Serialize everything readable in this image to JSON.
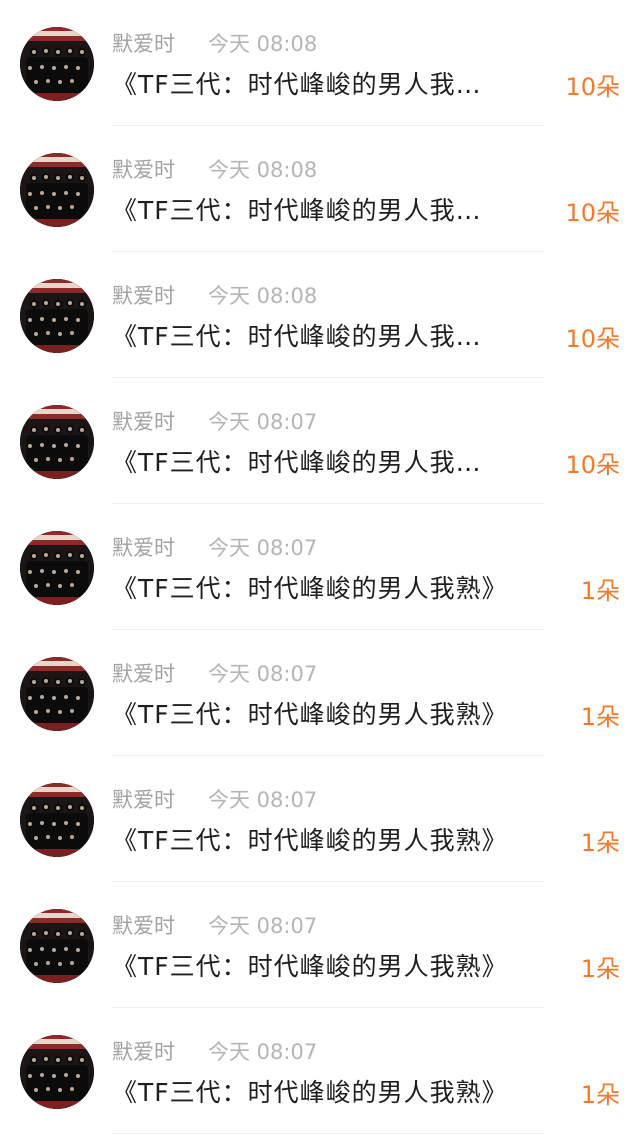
{
  "messages": [
    {
      "sender": "默爱时",
      "time": "今天 08:08",
      "title": "《TF三代：时代峰峻的男人我…",
      "gift": "10朵"
    },
    {
      "sender": "默爱时",
      "time": "今天 08:08",
      "title": "《TF三代：时代峰峻的男人我…",
      "gift": "10朵"
    },
    {
      "sender": "默爱时",
      "time": "今天 08:08",
      "title": "《TF三代：时代峰峻的男人我…",
      "gift": "10朵"
    },
    {
      "sender": "默爱时",
      "time": "今天 08:07",
      "title": "《TF三代：时代峰峻的男人我…",
      "gift": "10朵"
    },
    {
      "sender": "默爱时",
      "time": "今天 08:07",
      "title": "《TF三代：时代峰峻的男人我熟》",
      "gift": "1朵"
    },
    {
      "sender": "默爱时",
      "time": "今天 08:07",
      "title": "《TF三代：时代峰峻的男人我熟》",
      "gift": "1朵"
    },
    {
      "sender": "默爱时",
      "time": "今天 08:07",
      "title": "《TF三代：时代峰峻的男人我熟》",
      "gift": "1朵"
    },
    {
      "sender": "默爱时",
      "time": "今天 08:07",
      "title": "《TF三代：时代峰峻的男人我熟》",
      "gift": "1朵"
    },
    {
      "sender": "默爱时",
      "time": "今天 08:07",
      "title": "《TF三代：时代峰峻的男人我熟》",
      "gift": "1朵"
    }
  ],
  "colors": {
    "sender": "#a3a3a3",
    "time": "#b5b5b5",
    "title": "#1f1f1f",
    "gift": "#f27a2f",
    "separator": "#f0f0f0"
  }
}
